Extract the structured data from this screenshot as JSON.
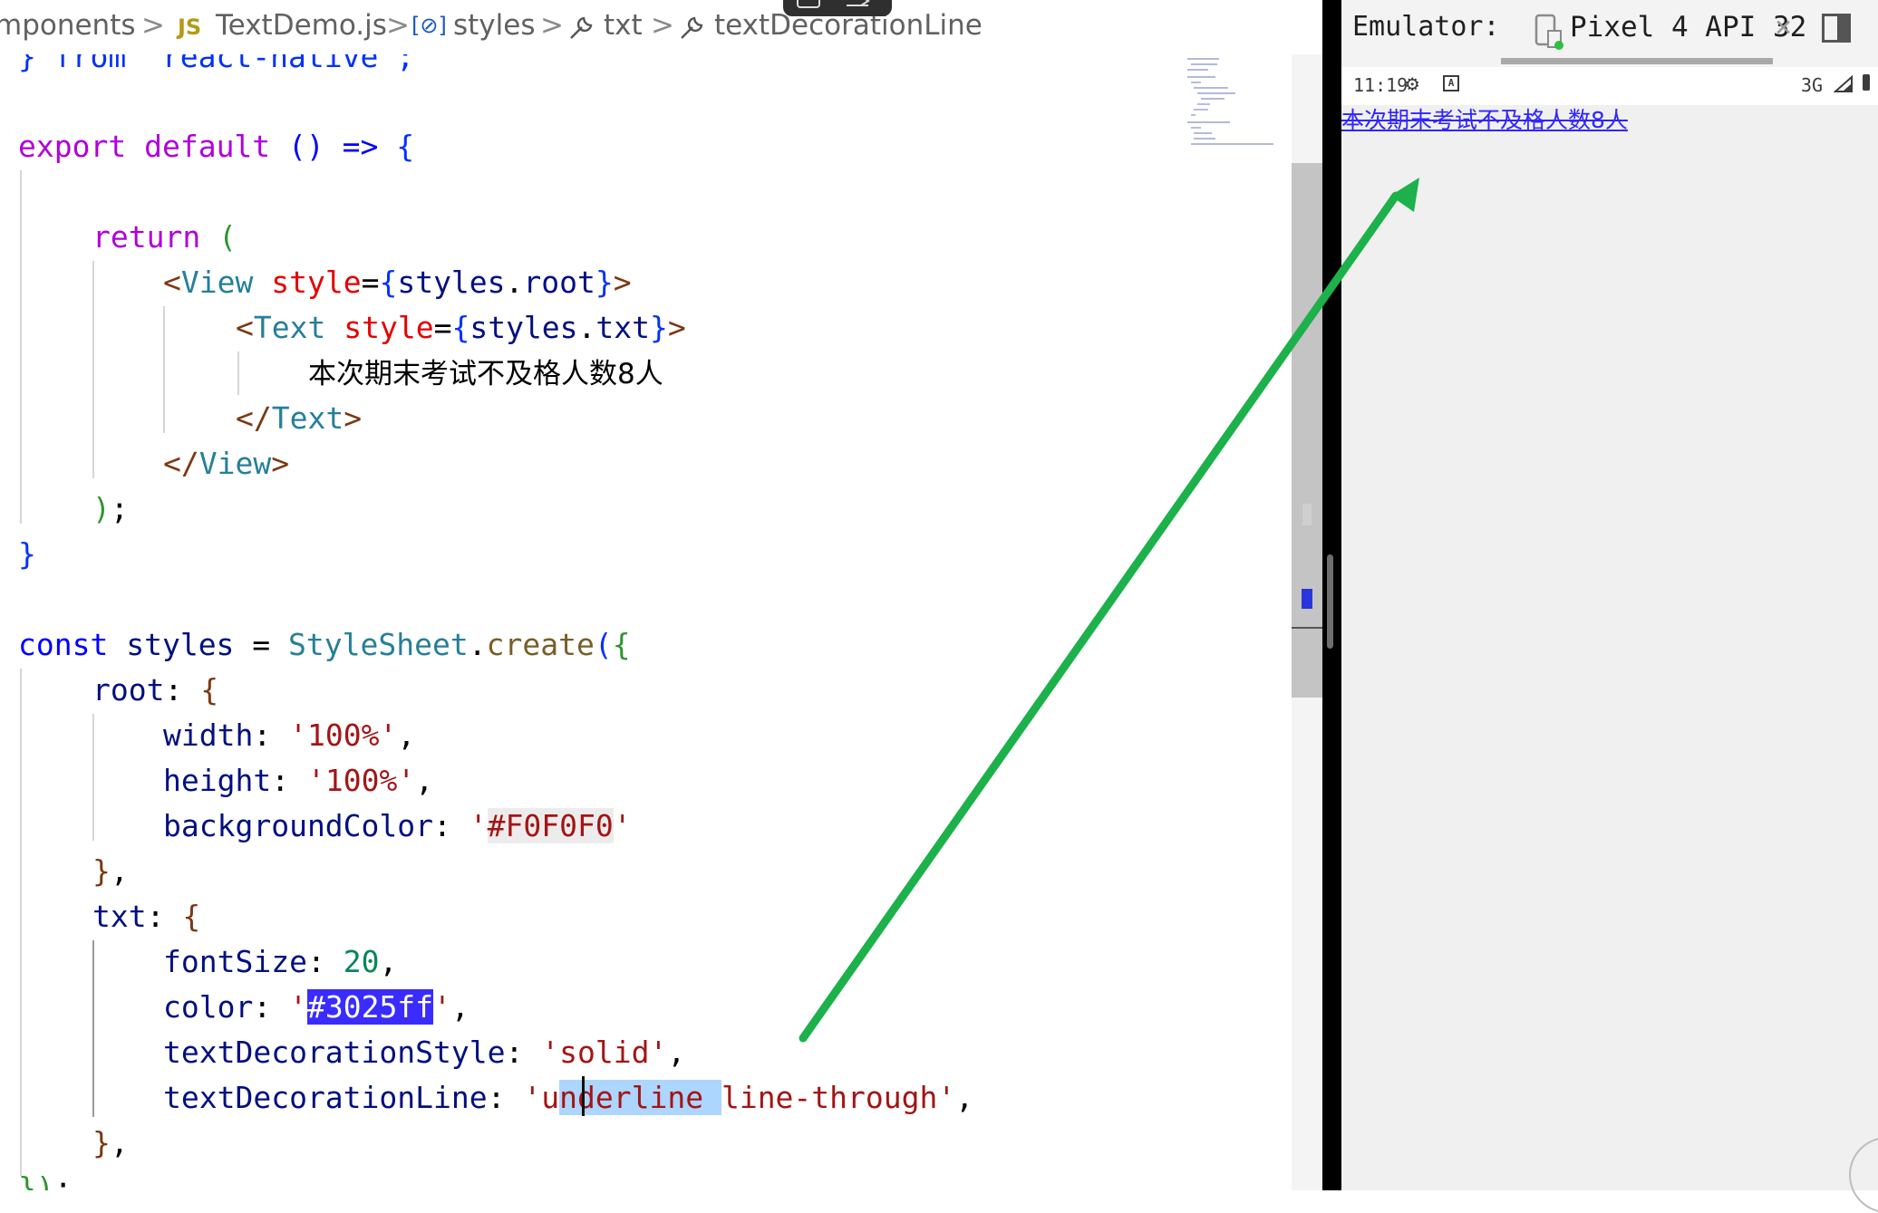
{
  "breadcrumb": {
    "items": [
      "mponents",
      "TextDemo.js",
      "styles",
      "txt",
      "textDecorationLine"
    ],
    "file_badge": "JS",
    "separator": ">",
    "object_icon": "[⊘]"
  },
  "code": {
    "l0": [
      "} from 'react-native';"
    ],
    "l1": [
      "export",
      " ",
      "default",
      " () => ",
      "{"
    ],
    "l2": [
      "return",
      " ",
      "("
    ],
    "l3": [
      "<",
      "View",
      " ",
      "style",
      "=",
      "{",
      "styles",
      ".",
      "root",
      "}",
      ">"
    ],
    "l4": [
      "<",
      "Text",
      " ",
      "style",
      "=",
      "{",
      "styles",
      ".",
      "txt",
      "}",
      ">"
    ],
    "l5": [
      "本次期末考试不及格人数8人"
    ],
    "l6": [
      "</",
      "Text",
      ">"
    ],
    "l7": [
      "</",
      "View",
      ">"
    ],
    "l8": [
      ")",
      ";"
    ],
    "l9": [
      "}"
    ],
    "l10": [
      "const",
      " ",
      "styles",
      " = ",
      "StyleSheet",
      ".",
      "create",
      "(",
      "{"
    ],
    "l11": [
      "root",
      ": ",
      "{"
    ],
    "l12": [
      "width",
      ": ",
      "'100%'",
      ","
    ],
    "l13": [
      "height",
      ": ",
      "'100%'",
      ","
    ],
    "l14": [
      "backgroundColor",
      ": ",
      "'",
      "#F0F0F0",
      "'"
    ],
    "l15": [
      "}",
      ","
    ],
    "l16": [
      "txt",
      ": ",
      "{"
    ],
    "l17": [
      "fontSize",
      ": ",
      "20",
      ","
    ],
    "l18": [
      "color",
      ": ",
      "'",
      "#3025ff",
      "'",
      ","
    ],
    "l19": [
      "textDecorationStyle",
      ": ",
      "'solid'",
      ","
    ],
    "l20": [
      "textDecorationLine",
      ": ",
      "'u",
      "n",
      "derline",
      " ",
      "line-through'",
      ","
    ],
    "l21": [
      "}",
      ","
    ],
    "l22": [
      "})",
      ";"
    ]
  },
  "emulator": {
    "label": "Emulator:",
    "device_name": "Pixel 4 API 32",
    "close_glyph": "×",
    "status_time": "11:19",
    "status_network": "3G",
    "status_gear_glyph": "⚙",
    "status_a_glyph": "A",
    "app_text": "本次期末考试不及格人数8人",
    "app_text_color": "#3025ff",
    "app_background": "#F0F0F0"
  },
  "colors": {
    "annotation_arrow": "#1db14b",
    "selection_highlight": "#3a2cff",
    "find_highlight": "#add6ff"
  },
  "icons": [
    "chevron-right-icon",
    "js-file-icon",
    "object-icon",
    "wrench-icon",
    "device-icon",
    "close-icon",
    "panel-toggle-icon",
    "gear-icon",
    "signal-icon",
    "battery-icon"
  ]
}
